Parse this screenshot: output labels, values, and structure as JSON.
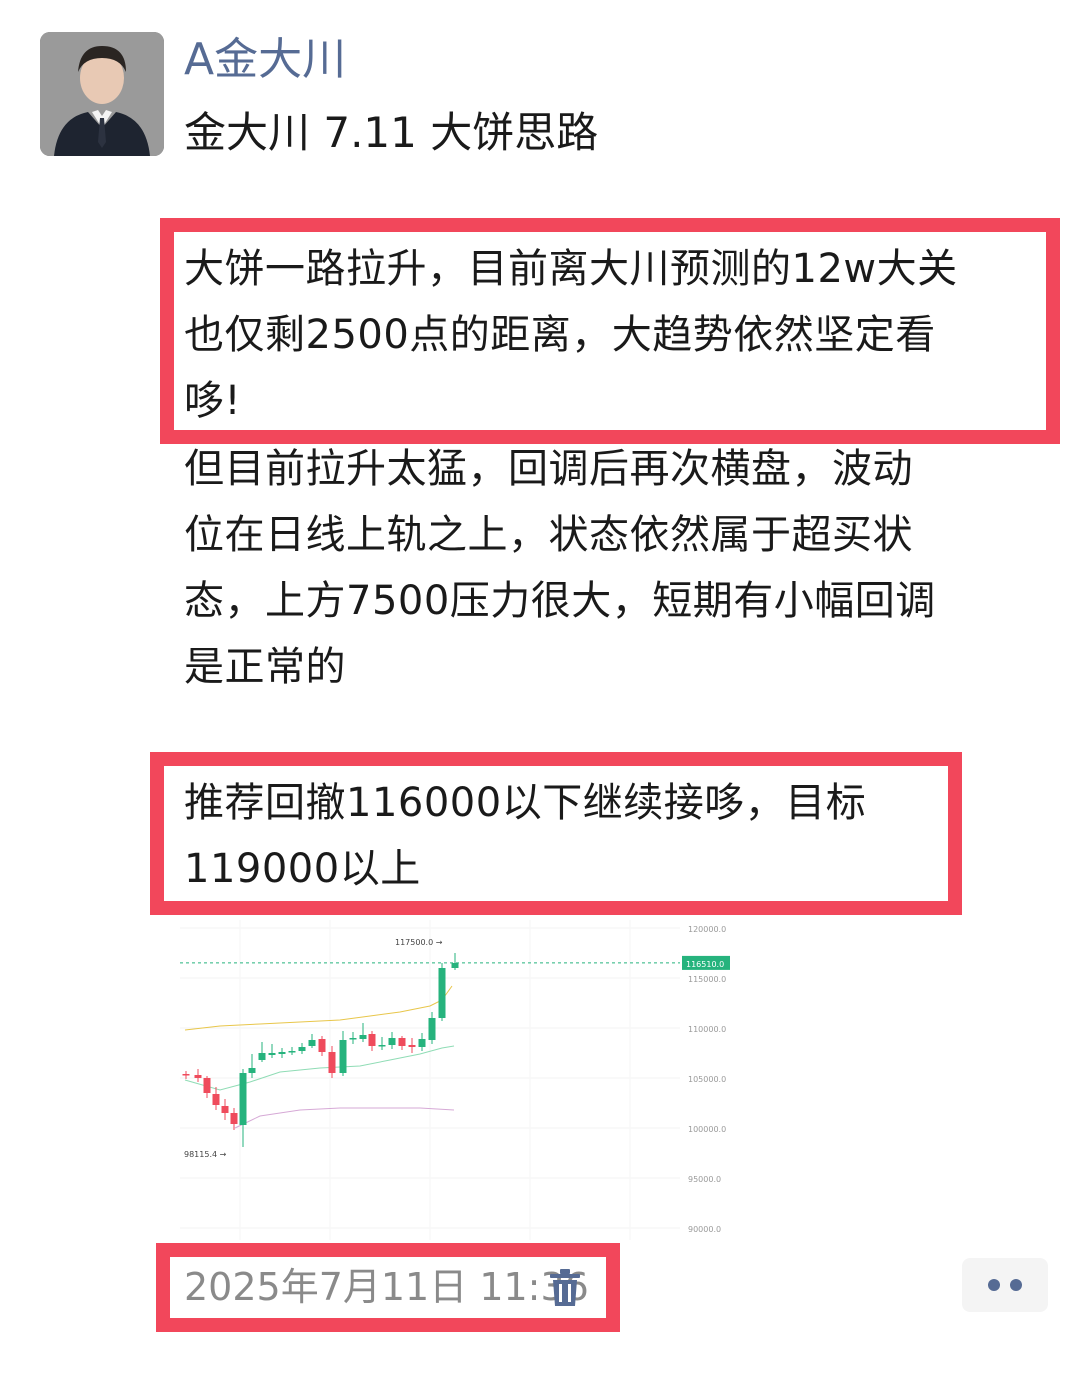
{
  "author": {
    "name": "A金大川"
  },
  "post": {
    "title": "金大川 7.11 大饼思路",
    "para1_lines": [
      "大饼一路拉升，目前离大川预测的12w大关",
      "也仅剩2500点的距离，大趋势依然坚定看",
      "哆!"
    ],
    "para2_lines": [
      "但目前拉升太猛，回调后再次横盘，波动",
      "位在日线上轨之上，状态依然属于超买状",
      "态，上方7500压力很大，短期有小幅回调",
      "是正常的"
    ],
    "para3_lines": [
      "推荐回撤116000以下继续接哆，目标",
      "119000以上"
    ],
    "timestamp": "2025年7月11日 11:36"
  },
  "chart_data": {
    "type": "candlestick",
    "y_axis_ticks": [
      "120000.0",
      "115000.0",
      "110000.0",
      "105000.0",
      "100000.0",
      "95000.0",
      "90000.0"
    ],
    "current_price_label": "116510.0",
    "high_label": "117500.0",
    "low_label": "98115.4",
    "colors": {
      "up": "#26b37d",
      "down": "#ef4b5c",
      "upper_band": "#e8c64a",
      "mid_band": "#8fdcb5",
      "lower_band": "#d6a9d6"
    }
  },
  "icons": {
    "delete": "trash-icon",
    "more": "more-dots-icon"
  }
}
